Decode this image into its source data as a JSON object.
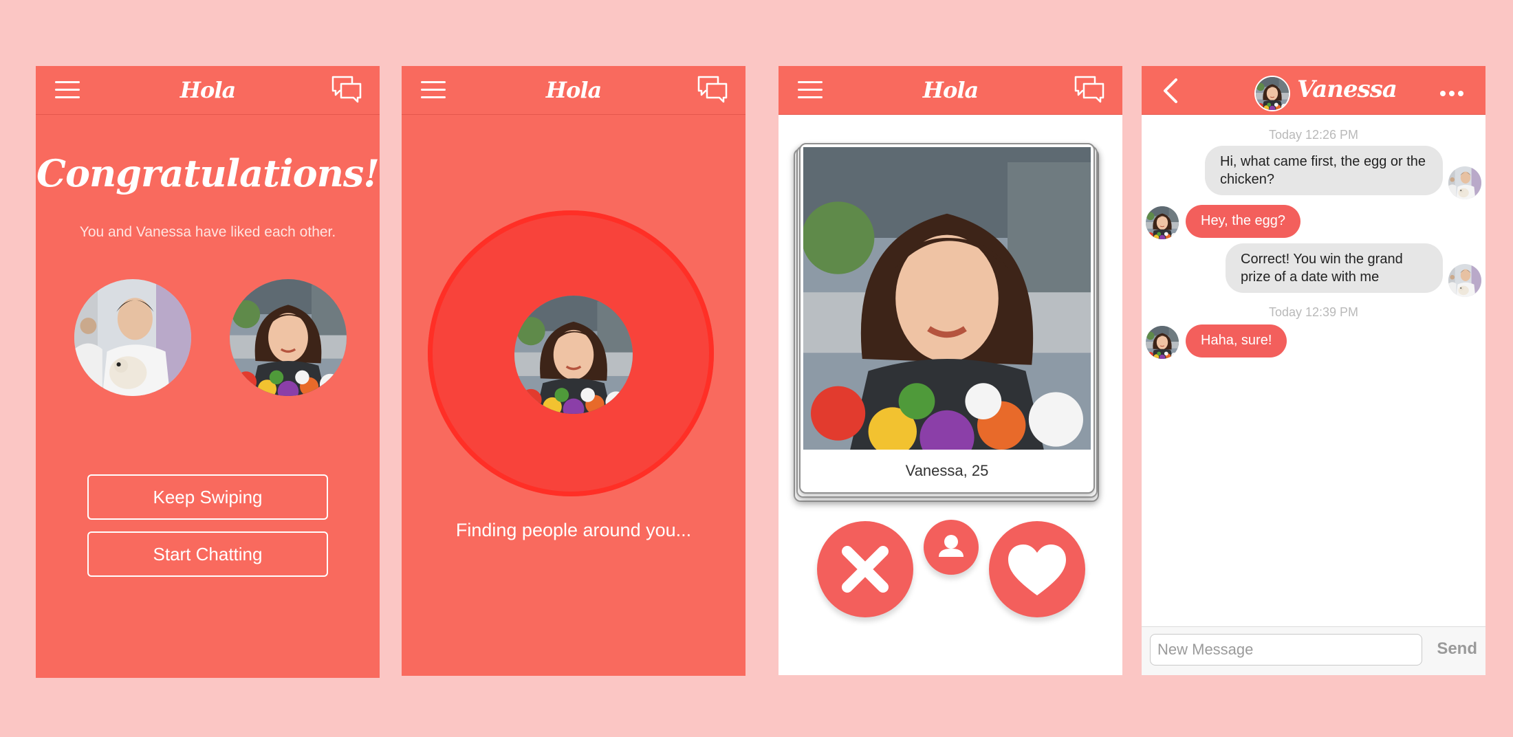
{
  "app": {
    "brand": "Hola"
  },
  "colors": {
    "accent": "#f96a5e",
    "background": "#fbc6c4",
    "bubble_out": "#e6e6e6",
    "bubble_in": "#f35f5c"
  },
  "screen_match": {
    "title": "Congratulations!",
    "subtitle": "You and Vanessa have liked each other.",
    "keep_swiping": "Keep Swiping",
    "start_chatting": "Start Chatting"
  },
  "screen_search": {
    "status": "Finding people around you..."
  },
  "screen_card": {
    "caption": "Vanessa, 25",
    "icons": [
      "dislike-x-icon",
      "profile-icon",
      "like-heart-icon"
    ]
  },
  "screen_chat": {
    "contact_name": "Vanessa",
    "messages": [
      {
        "time": "Today 12:26 PM"
      },
      {
        "from": "me",
        "text": "Hi, what came first, the egg or the chicken?"
      },
      {
        "from": "them",
        "text": "Hey, the egg?"
      },
      {
        "from": "me",
        "text": "Correct! You win the grand prize of a date with me"
      },
      {
        "time": "Today 12:39 PM"
      },
      {
        "from": "them",
        "text": "Haha, sure!"
      }
    ],
    "input_placeholder": "New Message",
    "send_label": "Send"
  }
}
